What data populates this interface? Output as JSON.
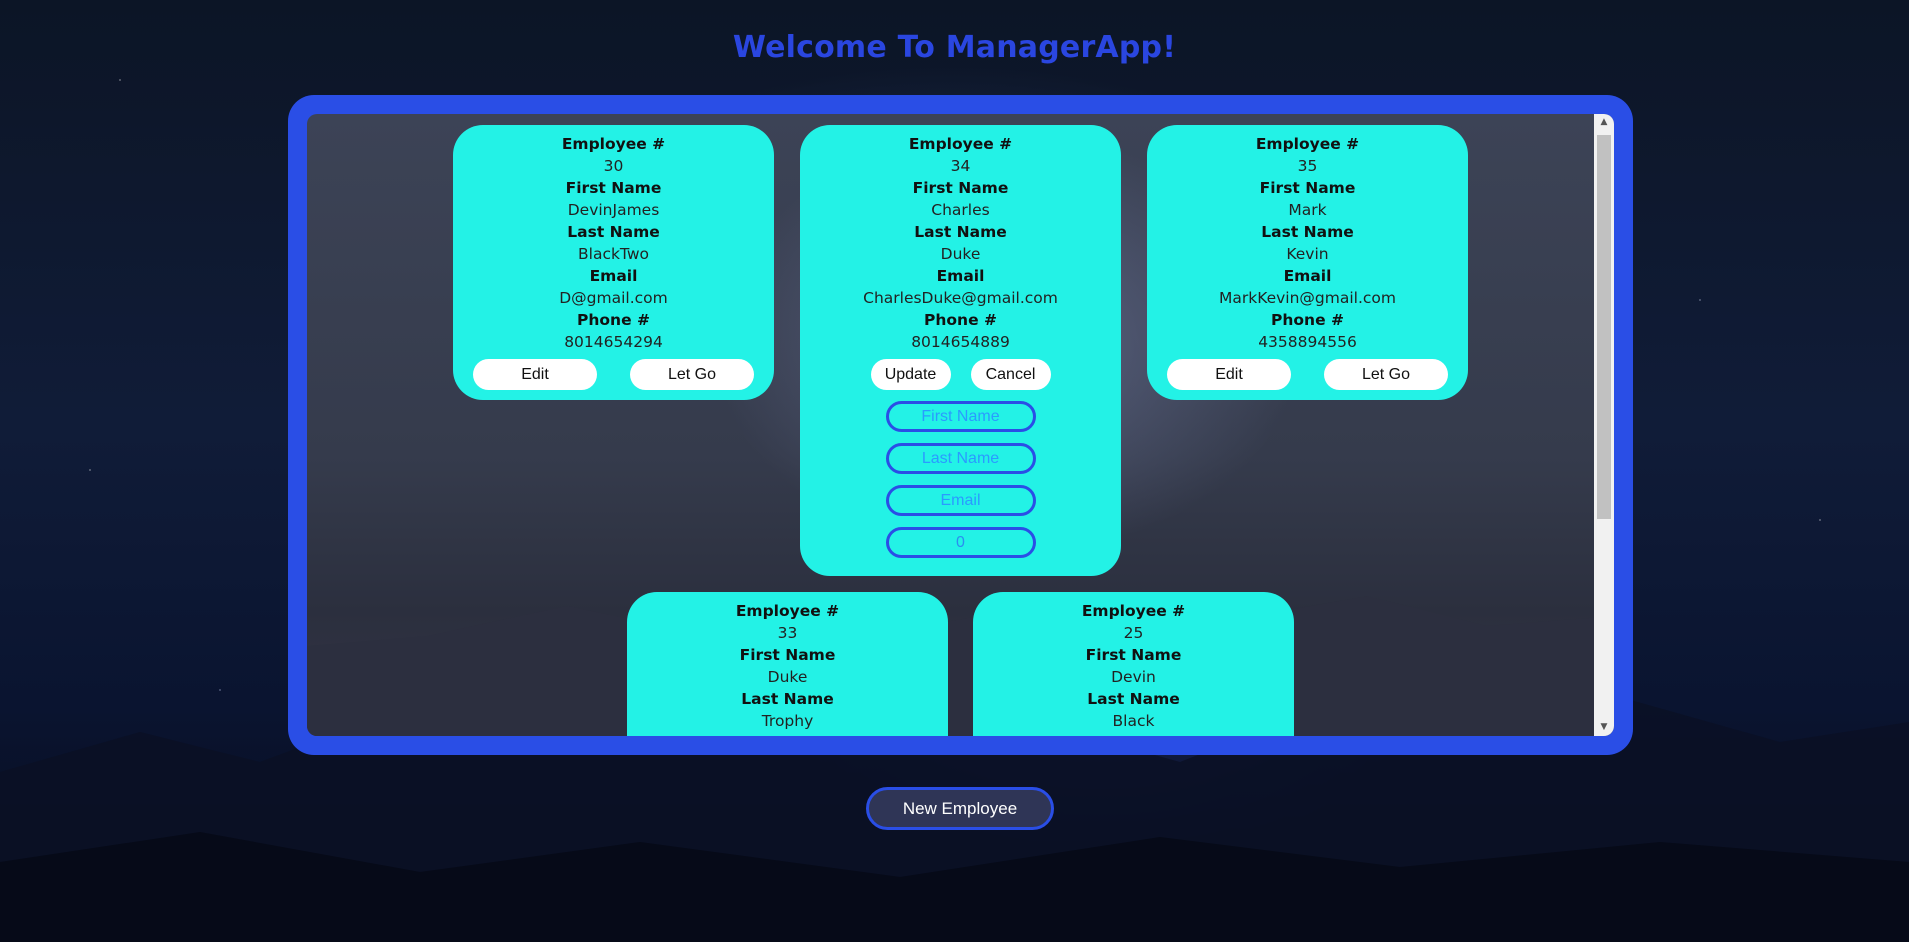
{
  "header": {
    "title": "Welcome To ManagerApp!"
  },
  "labels": {
    "employee_no": "Employee #",
    "first_name": "First Name",
    "last_name": "Last Name",
    "email": "Email",
    "phone": "Phone #"
  },
  "cards": [
    {
      "id": "30",
      "first": "DevinJames",
      "last": "BlackTwo",
      "email": "D@gmail.com",
      "phone": "8014654294",
      "btn1": "Edit",
      "btn2": "Let Go"
    },
    {
      "id": "34",
      "first": "Charles",
      "last": "Duke",
      "email": "CharlesDuke@gmail.com",
      "phone": "8014654889",
      "btn1": "Update",
      "btn2": "Cancel"
    },
    {
      "id": "35",
      "first": "Mark",
      "last": "Kevin",
      "email": "MarkKevin@gmail.com",
      "phone": "4358894556",
      "btn1": "Edit",
      "btn2": "Let Go"
    },
    {
      "id": "33",
      "first": "Duke",
      "last": "Trophy"
    },
    {
      "id": "25",
      "first": "Devin",
      "last": "Black"
    }
  ],
  "edit_form": {
    "first_placeholder": "First Name",
    "last_placeholder": "Last Name",
    "email_placeholder": "Email",
    "phone_value": "0"
  },
  "scrollbar": {
    "up": "▲",
    "down": "▼"
  },
  "footer": {
    "new_button": "New Employee"
  },
  "colors": {
    "accent": "#2a4ee6",
    "card": "#23f2e6",
    "title": "#2a46e0"
  }
}
